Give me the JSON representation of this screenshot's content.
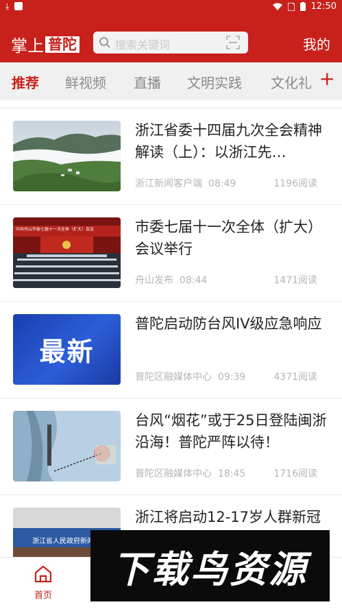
{
  "statusbar": {
    "time": "12:50"
  },
  "header": {
    "logo_prefix": "掌上",
    "logo_highlight": "普陀",
    "search_placeholder": "搜索关键词",
    "mine_label": "我的"
  },
  "tabs": [
    "推荐",
    "鲜视频",
    "直播",
    "文明实践",
    "文化礼"
  ],
  "tab_add_label": "+",
  "news": [
    {
      "title": "浙江省委十四届九次全会精神解读（上）：以浙江先…",
      "source": "浙江新闻客户端",
      "time": "08:49",
      "reads": "1196阅读",
      "thumb": "mountain-landscape"
    },
    {
      "title": "市委七届十一次全体（扩大）会议举行",
      "source": "舟山发布",
      "time": "08:44",
      "reads": "1471阅读",
      "thumb": "conference-hall",
      "thumb_banner": "中共舟山市委七届十一次全体（扩大）会议"
    },
    {
      "title": "普陀启动防台风IV级应急响应",
      "source": "普陀区融媒体中心",
      "time": "09:39",
      "reads": "4371阅读",
      "thumb": "latest-banner",
      "thumb_text": "最新"
    },
    {
      "title": "台风“烟花”或于25日登陆闽浙沿海！普陀严阵以待！",
      "source": "普陀区融媒体中心",
      "time": "18:45",
      "reads": "1716阅读",
      "thumb": "typhoon-map"
    },
    {
      "title": "浙江将启动12-17岁人群新冠",
      "source": "",
      "time": "",
      "reads": "",
      "thumb": "press-conference",
      "thumb_banner": "浙江省人民政府新闻办公"
    }
  ],
  "bottom_nav": {
    "home_label": "首页"
  },
  "watermark": "下载鸟资源",
  "colors": {
    "brand": "#c8201b",
    "tab_bg": "#f0f0f0"
  }
}
